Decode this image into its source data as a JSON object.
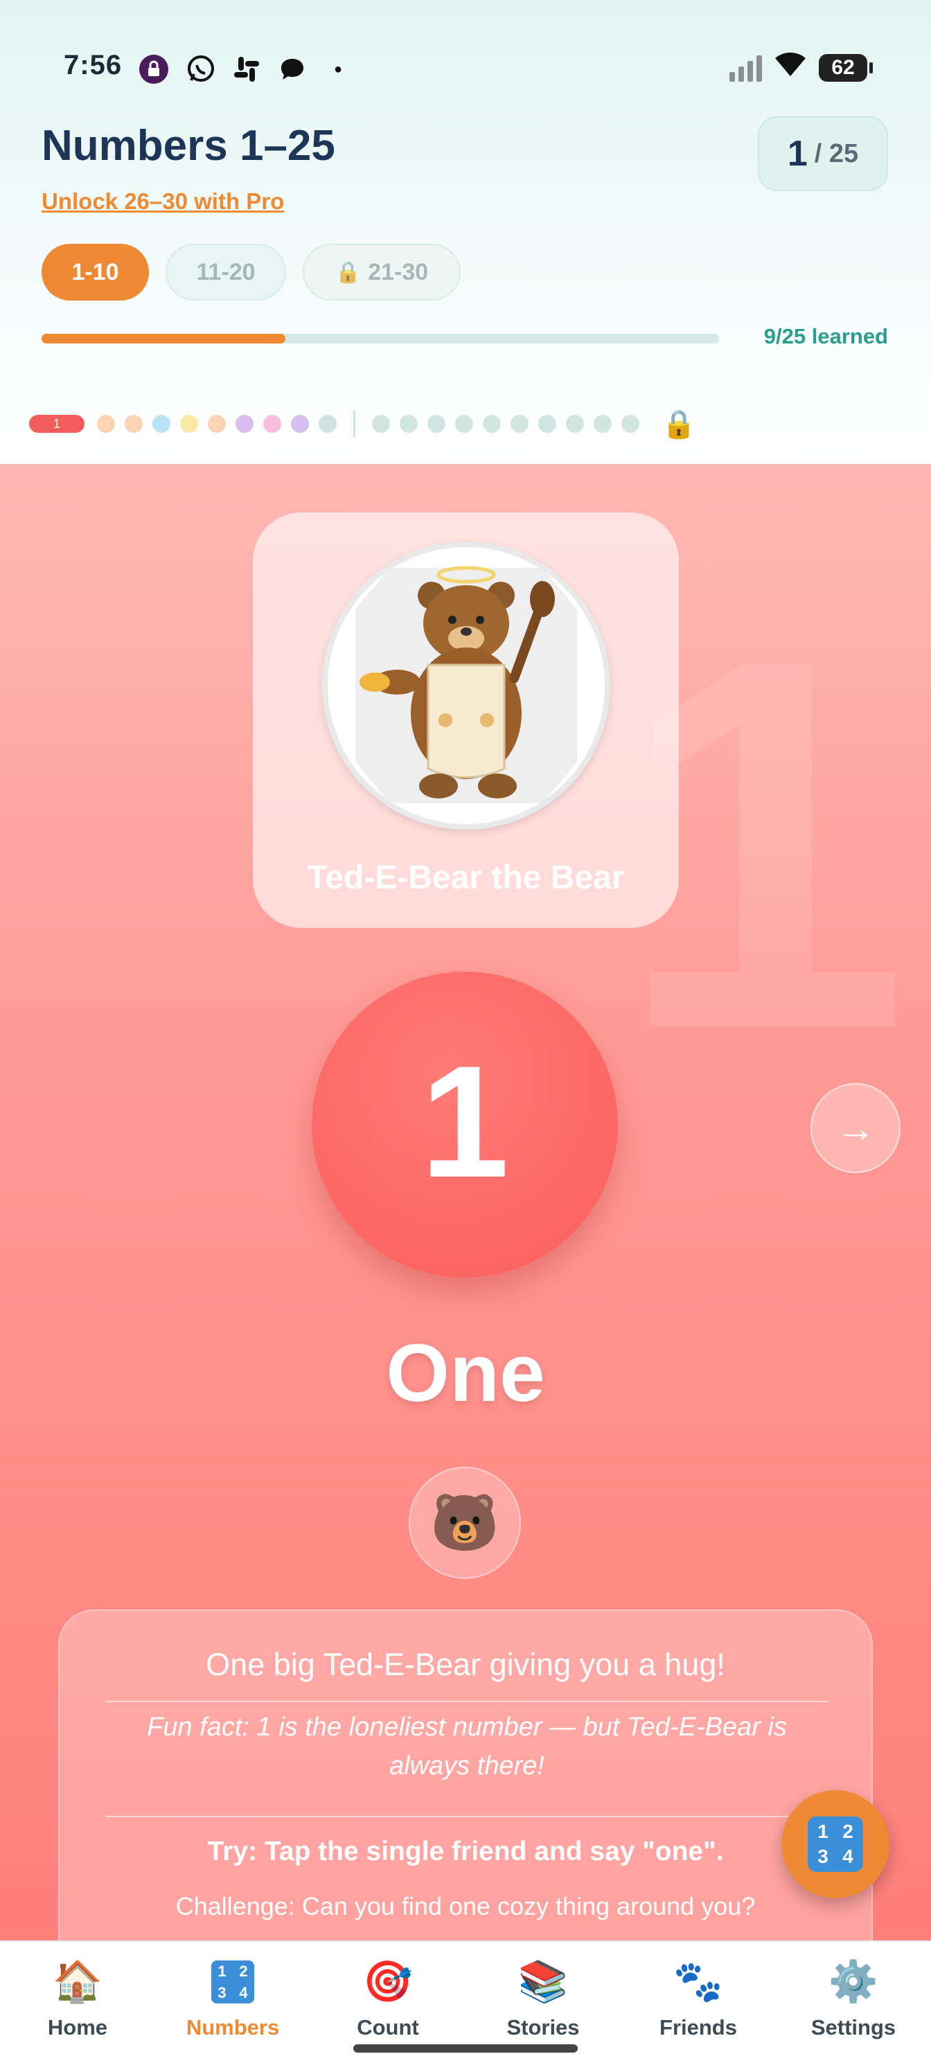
{
  "status_bar": {
    "time": "7:56",
    "battery": "62"
  },
  "header": {
    "title": "Numbers 1–25",
    "unlock_link": "Unlock 26–30 with Pro",
    "counter_current": "1",
    "counter_total": "/ 25"
  },
  "ranges": [
    {
      "label": "1-10"
    },
    {
      "label": "11-20"
    },
    {
      "label": "21-30",
      "locked": true
    }
  ],
  "progress": {
    "fraction": 0.36,
    "learned_text": "9/25 learned"
  },
  "dots": {
    "active_label": "1"
  },
  "friend_card": {
    "name": "Ted-E-Bear the Bear"
  },
  "number": {
    "digit": "1",
    "word": "One",
    "bg_digit": "1"
  },
  "info": {
    "line1": "One big Ted-E-Bear giving you a hug!",
    "fun_fact": "Fun fact: 1 is the loneliest number — but Ted-E-Bear is always there!",
    "try_text": "Try: Tap the single friend and say \"one\".",
    "challenge": "Challenge: Can you find one cozy thing around you?"
  },
  "fab_icon": "numbers-keycap-icon",
  "nav": [
    {
      "label": "Home",
      "icon": "house-icon"
    },
    {
      "label": "Numbers",
      "icon": "numbers-icon"
    },
    {
      "label": "Count",
      "icon": "target-icon"
    },
    {
      "label": "Stories",
      "icon": "books-icon"
    },
    {
      "label": "Friends",
      "icon": "paw-icon"
    },
    {
      "label": "Settings",
      "icon": "gear-icon"
    }
  ],
  "colors": {
    "accent": "#ef8a34",
    "teal": "#2a9d8f",
    "coral": "#fa5e5c",
    "navy": "#1d3557"
  }
}
